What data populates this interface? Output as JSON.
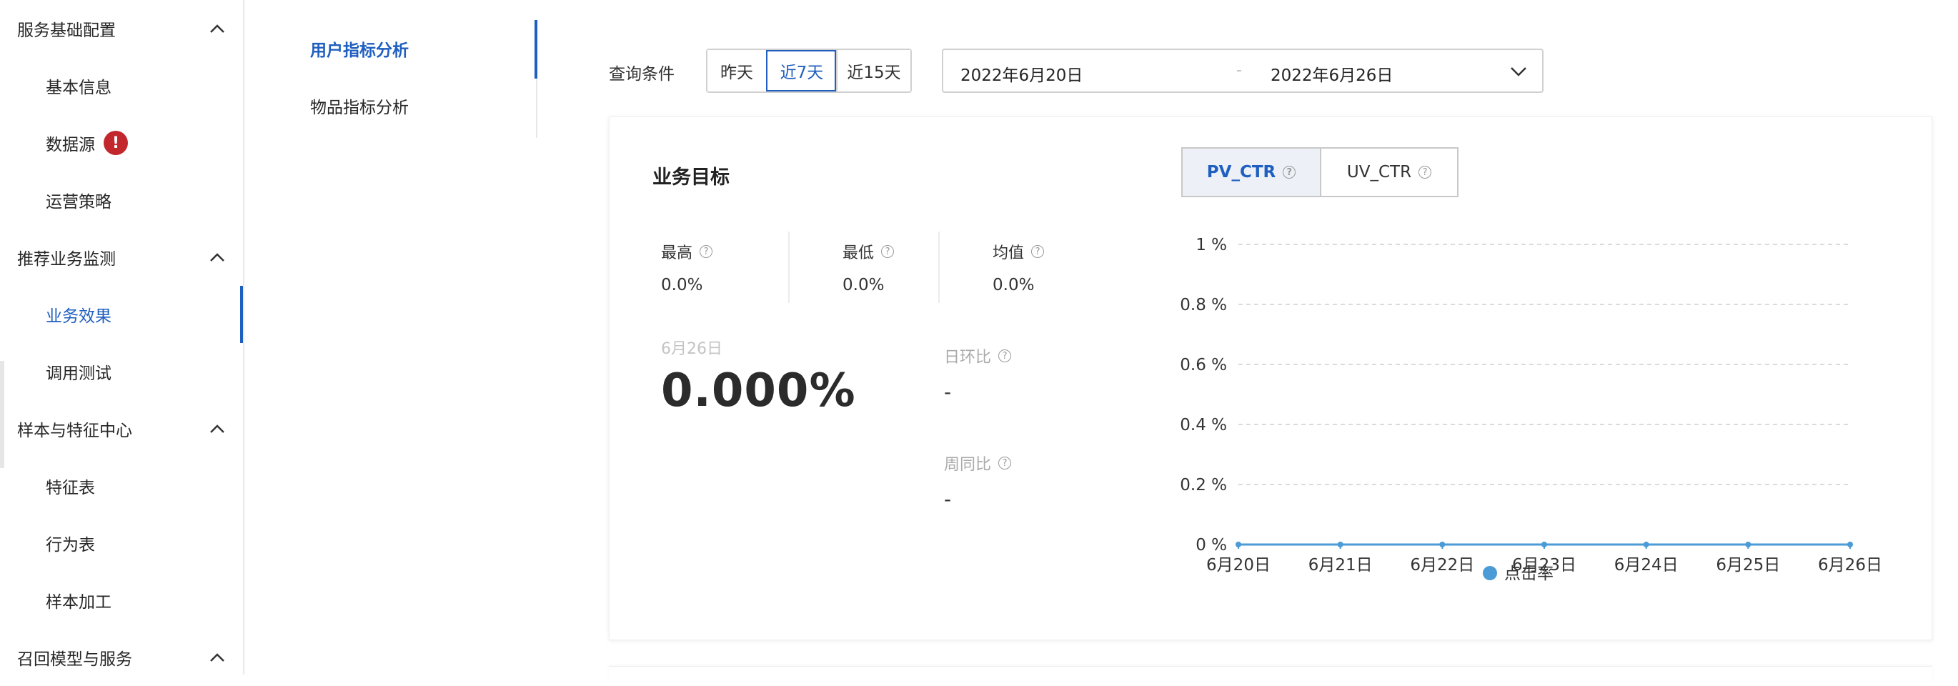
{
  "sidebar": {
    "groups": [
      {
        "label": "服务基础配置",
        "items": [
          {
            "label": "基本信息"
          },
          {
            "label": "数据源",
            "alert": "!"
          },
          {
            "label": "运营策略"
          }
        ]
      },
      {
        "label": "推荐业务监测",
        "items": [
          {
            "label": "业务效果"
          },
          {
            "label": "调用测试"
          }
        ]
      },
      {
        "label": "样本与特征中心",
        "items": [
          {
            "label": "特征表"
          },
          {
            "label": "行为表"
          },
          {
            "label": "样本加工"
          }
        ]
      },
      {
        "label": "召回模型与服务",
        "items": []
      }
    ],
    "active_item": "业务效果"
  },
  "subnav": {
    "items": [
      {
        "label": "用户指标分析"
      },
      {
        "label": "物品指标分析"
      }
    ],
    "active": "用户指标分析"
  },
  "query": {
    "label": "查询条件",
    "ranges": [
      "昨天",
      "近7天",
      "近15天"
    ],
    "active_range": "近7天",
    "date_start": "2022年6月20日",
    "date_separator": "-",
    "date_end": "2022年6月26日"
  },
  "card": {
    "title": "业务目标",
    "stats": [
      {
        "label": "最高",
        "value": "0.0%"
      },
      {
        "label": "最低",
        "value": "0.0%"
      },
      {
        "label": "均值",
        "value": "0.0%"
      }
    ],
    "current_date": "6月26日",
    "current_value": "0.000%",
    "comparisons": [
      {
        "label": "日环比",
        "value": "-"
      },
      {
        "label": "周同比",
        "value": "-"
      }
    ],
    "metric_tabs": [
      "PV_CTR",
      "UV_CTR"
    ],
    "active_metric": "PV_CTR"
  },
  "colors": {
    "accent": "#1f5fbf",
    "alert": "#c1272d",
    "series": "#4b9bd6"
  },
  "chart_data": {
    "type": "line",
    "categories": [
      "6月20日",
      "6月21日",
      "6月22日",
      "6月23日",
      "6月24日",
      "6月25日",
      "6月26日"
    ],
    "series": [
      {
        "name": "点击率",
        "values": [
          0,
          0,
          0,
          0,
          0,
          0,
          0
        ]
      }
    ],
    "y_ticks": [
      "0 %",
      "0.2 %",
      "0.4 %",
      "0.6 %",
      "0.8 %",
      "1 %"
    ],
    "ylim": [
      0,
      1
    ],
    "grid": true,
    "legend_position": "bottom"
  }
}
